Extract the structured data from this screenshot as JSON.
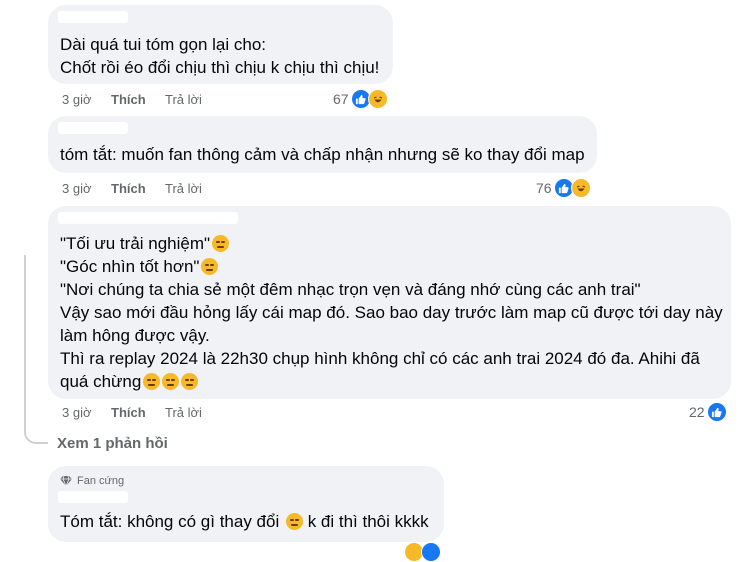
{
  "comments": [
    {
      "lines": [
        "Dài quá tui tóm gọn lại cho:",
        "Chốt rồi éo đổi chịu thì chịu k chịu thì chịu!"
      ],
      "time": "3 giờ",
      "like": "Thích",
      "reply": "Trả lời",
      "reaction_count": "67",
      "reactions": [
        "like-icon",
        "haha-icon"
      ]
    },
    {
      "lines": [
        "tóm tắt: muốn fan thông cảm và chấp nhận nhưng sẽ ko thay đổi map"
      ],
      "time": "3 giờ",
      "like": "Thích",
      "reply": "Trả lời",
      "reaction_count": "76",
      "reactions": [
        "like-icon",
        "haha-icon"
      ]
    },
    {
      "lines": [
        "\"Tối ưu trải nghiệm\"",
        "\"Góc nhìn tốt hơn\"",
        "\"Nơi chúng ta chia sẻ một đêm nhạc trọn vẹn và đáng nhớ cùng các anh trai\"",
        "Vậy sao mới đầu hỏng lấy cái map đó. Sao bao day trước làm map cũ được tới day này",
        "làm hông được vậy.",
        "Thì ra replay 2024 là 22h30 chụp hình không chỉ có các anh trai 2024 đó đa. Ahihi đã",
        "quá chừng"
      ],
      "time": "3 giờ",
      "like": "Thích",
      "reply": "Trả lời",
      "reaction_count": "22",
      "reactions": [
        "like-icon"
      ],
      "see_replies": "Xem 1 phản hồi"
    },
    {
      "badge": "Fan cứng",
      "lines": [
        "Tóm tắt: không có gì thay đổi",
        "k đi thì thôi kkkk"
      ]
    }
  ],
  "colors": {
    "bubble": "#f0f2f5",
    "meta_text": "#65676b",
    "like_blue": "#1877f2",
    "haha_yellow": "#f7b928"
  }
}
